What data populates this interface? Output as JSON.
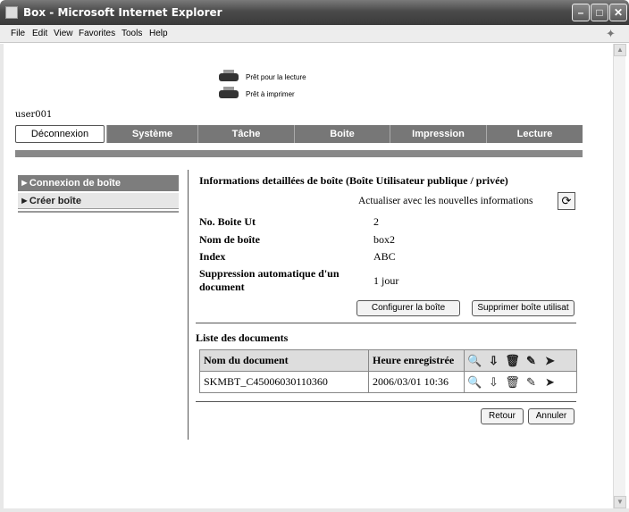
{
  "window": {
    "title": "Box - Microsoft Internet Explorer"
  },
  "menubar": {
    "items": [
      "File",
      "Edit",
      "View",
      "Favorites",
      "Tools",
      "Help"
    ]
  },
  "status": {
    "ready_read": "Prêt pour la lecture",
    "ready_print": "Prêt à imprimer"
  },
  "user": {
    "name": "user001"
  },
  "nav": {
    "logout_label": "Déconnexion",
    "tabs": [
      "Système",
      "Tâche",
      "Boite",
      "Impression",
      "Lecture"
    ]
  },
  "sidebar": {
    "items": [
      "Connexion de boîte",
      "Créer boîte"
    ]
  },
  "detail": {
    "heading": "Informations detaillées de boîte (Boîte Utilisateur publique / privée)",
    "refresh_text": "Actualiser avec les nouvelles informations",
    "fields": [
      {
        "label": "No. Boite Ut",
        "value": "2"
      },
      {
        "label": "Nom de boîte",
        "value": "box2"
      },
      {
        "label": "Index",
        "value": "ABC"
      },
      {
        "label": "Suppression automatique d'un document",
        "value": "1 jour"
      }
    ],
    "configure_button": "Configurer la boîte",
    "delete_button": "Supprimer boîte utilisat"
  },
  "documents": {
    "title": "Liste des documents",
    "columns": [
      "Nom du document",
      "Heure enregistrée"
    ],
    "rows": [
      {
        "name": "SKMBT_C45006030110360",
        "time": "2006/03/01  10:36"
      }
    ]
  },
  "footer": {
    "back_button": "Retour",
    "cancel_button": "Annuler"
  },
  "icons": [
    "app-icon",
    "ie-logo-icon",
    "printer-icon",
    "refresh-icon",
    "view-icon",
    "download-icon",
    "delete-icon",
    "edit-icon",
    "send-icon",
    "scroll-up-icon",
    "scroll-down-icon"
  ],
  "colors": {
    "tab_bg": "#777777",
    "active_menu": "#7d7d7d",
    "titlebar": "#4a4a4a"
  }
}
